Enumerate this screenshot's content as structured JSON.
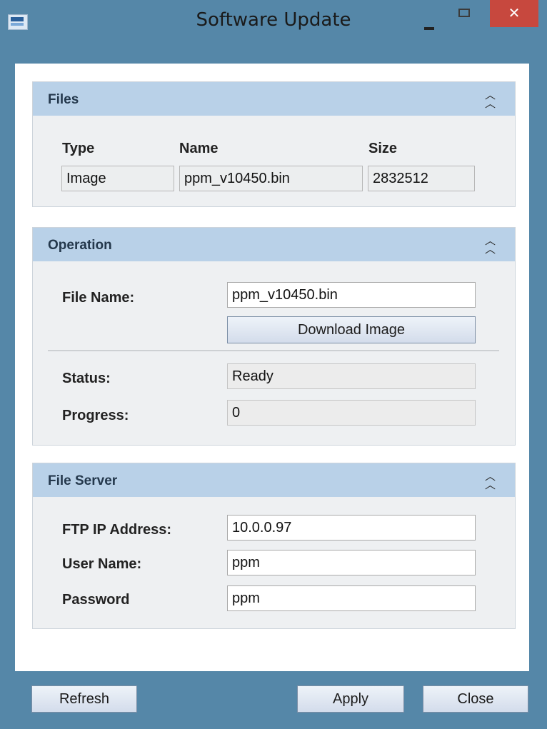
{
  "window": {
    "title": "Software Update",
    "close_glyph": "✕"
  },
  "files": {
    "title": "Files",
    "columns": [
      "Type",
      "Name",
      "Size"
    ],
    "values": {
      "type": "Image",
      "name": "ppm_v10450.bin",
      "size": "2832512"
    }
  },
  "operation": {
    "title": "Operation",
    "file_name_label": "File Name:",
    "file_name_value": "ppm_v10450.bin",
    "download_button": "Download Image",
    "status_label": "Status:",
    "status_value": "Ready",
    "progress_label": "Progress:",
    "progress_value": "0"
  },
  "file_server": {
    "title": "File Server",
    "ftp_label": "FTP IP Address:",
    "ftp_value": "10.0.0.97",
    "user_label": "User Name:",
    "user_value": "ppm",
    "password_label": "Password",
    "password_value": "ppm"
  },
  "footer": {
    "refresh": "Refresh",
    "apply": "Apply",
    "close": "Close"
  },
  "icons": {
    "collapse": "double-chevron-up-icon",
    "minimize": "minimize-icon",
    "maximize": "maximize-icon",
    "close": "close-icon"
  },
  "colors": {
    "frame": "#5587a8",
    "panel_header": "#b9d1e8",
    "close_button": "#c7483e"
  }
}
